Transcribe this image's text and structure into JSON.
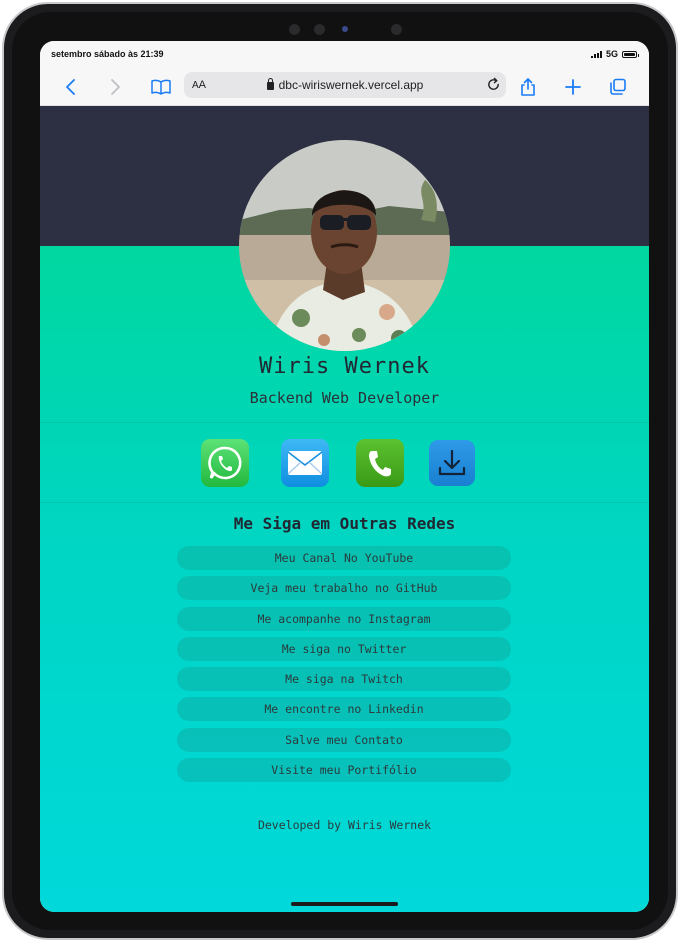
{
  "status_bar": {
    "time": "setembro sábado às 21:39",
    "network": "5G"
  },
  "browser": {
    "aa_small": "A",
    "aa_big": "A",
    "url": "dbc-wiriswernek.vercel.app"
  },
  "profile": {
    "name": "Wiris Wernek",
    "role": "Backend Web Developer"
  },
  "contact_icons": [
    "whatsapp-icon",
    "mail-icon",
    "phone-icon",
    "download-icon"
  ],
  "colors": {
    "header_dark": "#2d3042",
    "gradient_top": "#00d88e",
    "gradient_bottom": "#00d8da",
    "whatsapp": "#25d366",
    "mail": "#1ea0f2",
    "phone": "#4cae1f",
    "download": "#1a8fe0"
  },
  "social": {
    "title": "Me Siga em Outras Redes",
    "links": [
      "Meu Canal No YouTube",
      "Veja meu trabalho no GitHub",
      "Me acompanhe no Instagram",
      "Me siga no Twitter",
      "Me siga na Twitch",
      "Me encontre no Linkedin",
      "Salve meu Contato",
      "Visite meu Portifólio"
    ]
  },
  "footer": {
    "text": "Developed by Wiris Wernek"
  }
}
